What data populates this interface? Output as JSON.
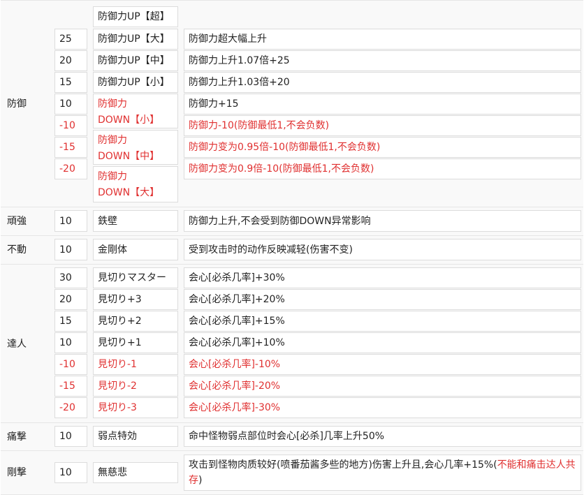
{
  "sections": [
    {
      "skill": "防御",
      "rows": [
        {
          "points": "",
          "name": "防御力UP【超】",
          "desc": "",
          "red": false
        },
        {
          "points": "25",
          "name": "防御力UP【大】",
          "desc": "防御力超大幅上升",
          "red": false
        },
        {
          "points": "20",
          "name": "防御力UP【中】",
          "desc": "防御力上升1.07倍+25",
          "red": false
        },
        {
          "points": "15",
          "name": "防御力UP【小】",
          "desc": "防御力上升1.03倍+20",
          "red": false
        },
        {
          "points": "10",
          "name": "防御力DOWN【小】",
          "name_l1": "防御力",
          "name_l2": "DOWN【小】",
          "desc": "防御力+15",
          "red": false
        },
        {
          "points": "-10",
          "name": "防御力DOWN【中】",
          "name_l1": "防御力",
          "name_l2": "DOWN【中】",
          "desc": "防御力-10(防御最低1,不会负数)",
          "red": true
        },
        {
          "points": "-15",
          "name": "防御力DOWN【大】",
          "name_l1": "防御力",
          "name_l2": "DOWN【大】",
          "desc": "防御力变为0.95倍-10(防御最低1,不会负数)",
          "red": true
        },
        {
          "points": "-20",
          "name": "",
          "desc": "防御力变为0.9倍-10(防御最低1,不会负数)",
          "red": true
        }
      ]
    },
    {
      "skill": "頑強",
      "rows": [
        {
          "points": "10",
          "name": "鉄壁",
          "desc": "防御力上升,不会受到防御DOWN异常影响",
          "red": false
        }
      ]
    },
    {
      "skill": "不動",
      "rows": [
        {
          "points": "10",
          "name": "金剛体",
          "desc": "受到攻击时的动作反映减轻(伤害不变)",
          "red": false
        }
      ]
    },
    {
      "skill": "達人",
      "rows": [
        {
          "points": "30",
          "name": "見切りマスター",
          "desc": "会心[必杀几率]+30%",
          "red": false
        },
        {
          "points": "20",
          "name": "見切り+3",
          "desc": "会心[必杀几率]+20%",
          "red": false
        },
        {
          "points": "15",
          "name": "見切り+2",
          "desc": "会心[必杀几率]+15%",
          "red": false
        },
        {
          "points": "10",
          "name": "見切り+1",
          "desc": "会心[必杀几率]+10%",
          "red": false
        },
        {
          "points": "-10",
          "name": "見切り-1",
          "desc": "会心[必杀几率]-10%",
          "red": true
        },
        {
          "points": "-15",
          "name": "見切り-2",
          "desc": "会心[必杀几率]-20%",
          "red": true
        },
        {
          "points": "-20",
          "name": "見切り-3",
          "desc": "会心[必杀几率]-30%",
          "red": true
        }
      ]
    },
    {
      "skill": "痛撃",
      "rows": [
        {
          "points": "10",
          "name": "弱点特効",
          "desc": "命中怪物弱点部位时会心[必杀]几率上升50%",
          "red": false
        }
      ]
    },
    {
      "skill": "剛撃",
      "rows": [
        {
          "points": "10",
          "name": "無慈悲",
          "desc": "攻击到怪物肉质较好(喷番茄酱多些的地方)伤害上升且,会心几率+15%(",
          "desc_red": "不能和痛击达人共存",
          "desc_end": ")",
          "red": false
        }
      ]
    }
  ],
  "colors": {
    "red": "#e03030",
    "text": "#222222",
    "section_bg": "#f9f9f9",
    "border": "#dcdcdc"
  }
}
